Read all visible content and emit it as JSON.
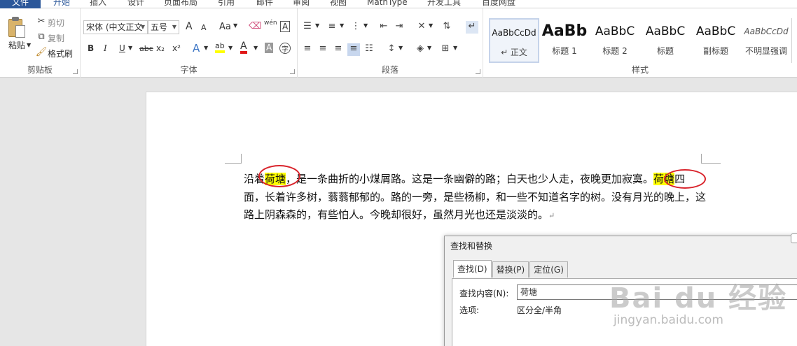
{
  "menubar": {
    "file_label": "文件",
    "tabs": [
      "开始",
      "插入",
      "设计",
      "页面布局",
      "引用",
      "邮件",
      "审阅",
      "视图",
      "MathType",
      "开发工具",
      "百度网盘"
    ]
  },
  "clipboard": {
    "paste_label": "粘贴",
    "cut_label": "剪切",
    "copy_label": "复制",
    "format_painter_label": "格式刷",
    "group_label": "剪贴板"
  },
  "font": {
    "font_name": "宋体 (中文正文",
    "font_size": "五号",
    "grow_glyph": "A",
    "shrink_glyph": "A",
    "case_glyph": "Aa",
    "pinyin_glyph": "wén",
    "border_glyph": "A",
    "bold": "B",
    "italic": "I",
    "underline": "U",
    "strike": "abc",
    "subscript": "x₂",
    "superscript": "x²",
    "effect_glyph": "A",
    "highlight_glyph": "ab",
    "color_glyph": "A",
    "shade_glyph": "A",
    "enclose_glyph": "字",
    "group_label": "字体"
  },
  "paragraph": {
    "group_label": "段落"
  },
  "styles": {
    "items": [
      {
        "preview": "AaBbCcDd",
        "name": "↵ 正文"
      },
      {
        "preview": "AaBb",
        "name": "标题 1"
      },
      {
        "preview": "AaBbC",
        "name": "标题 2"
      },
      {
        "preview": "AaBbC",
        "name": "标题"
      },
      {
        "preview": "AaBbC",
        "name": "副标题"
      },
      {
        "preview": "AaBbCcDd",
        "name": "不明显强调"
      }
    ],
    "group_label": "样式"
  },
  "document": {
    "text_1": "沿着",
    "highlight_1": "荷塘",
    "text_2": "，是一条曲折的小煤屑路。这是一条幽僻的路；白天也少人走，夜晚更加寂寞。",
    "highlight_2": "荷塘",
    "text_3": "四面，长着许多树，蓊蓊郁郁的。路的一旁，是些杨柳，和一些不知道名字的树。没有月光的晚上，这路上阴森森的，有些怕人。今晚却很好，虽然月光也还是淡淡的。",
    "paragraph_mark": "↵",
    "highlight_color": "#ffff00",
    "circle_color": "#d9232b"
  },
  "dialog": {
    "title": "查找和替换",
    "tabs": [
      "查找(D)",
      "替换(P)",
      "定位(G)"
    ],
    "find_label": "查找内容(N):",
    "find_value": "荷塘",
    "options_label": "选项:",
    "options_value": "区分全/半角"
  },
  "watermark": {
    "brand": "Bai du 经验",
    "url": "jingyan.baidu.com"
  }
}
